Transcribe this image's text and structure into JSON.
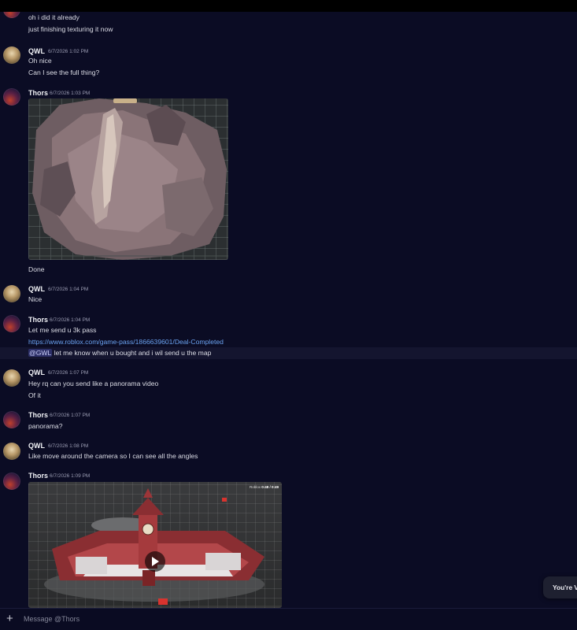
{
  "messages": [
    {
      "author": "",
      "time": "",
      "lines": [
        "oh i did it already",
        "just finishing texturing it now"
      ]
    },
    {
      "author": "QWL",
      "time": "6/7/2026 1:02 PM",
      "lines": [
        "Oh nice",
        "Can I see the full thing?"
      ]
    },
    {
      "author": "Thors",
      "time": "6/7/2026 1:03 PM",
      "lines": [
        "Done"
      ]
    },
    {
      "author": "QWL",
      "time": "6/7/2026 1:04 PM",
      "lines": [
        "Nice"
      ]
    },
    {
      "author": "Thors",
      "time": "6/7/2026 1:04 PM",
      "lines": [
        "Let me send u 3k pass"
      ],
      "link": "https://www.roblox.com/game-pass/1866639601/Deal-Completed",
      "mention": "@GWL",
      "mention_text": " let me know when u bought and  i wil send u the map"
    },
    {
      "author": "QWL",
      "time": "6/7/2026 1:07 PM",
      "lines": [
        "Hey rq can you send like a panorama video",
        "Of it"
      ]
    },
    {
      "author": "Thors",
      "time": "6/7/2026 1:07 PM",
      "lines": [
        "panorama?"
      ]
    },
    {
      "author": "QWL",
      "time": "6/7/2026 1:08 PM",
      "lines": [
        "Like move around the camera so I can see all the angles"
      ]
    },
    {
      "author": "Thors",
      "time": "6/7/2026 1:09 PM",
      "lines": []
    }
  ],
  "video_overlay": {
    "label": "Roblox",
    "counter": "0:48 / 0:49"
  },
  "toast": "You're Vi",
  "composer": {
    "placeholder": "Message @Thors",
    "plus_icon": "plus-icon"
  },
  "colors": {
    "background": "#0b0c24",
    "link": "#6aa2f0",
    "mention_bg": "#2c2f67"
  }
}
